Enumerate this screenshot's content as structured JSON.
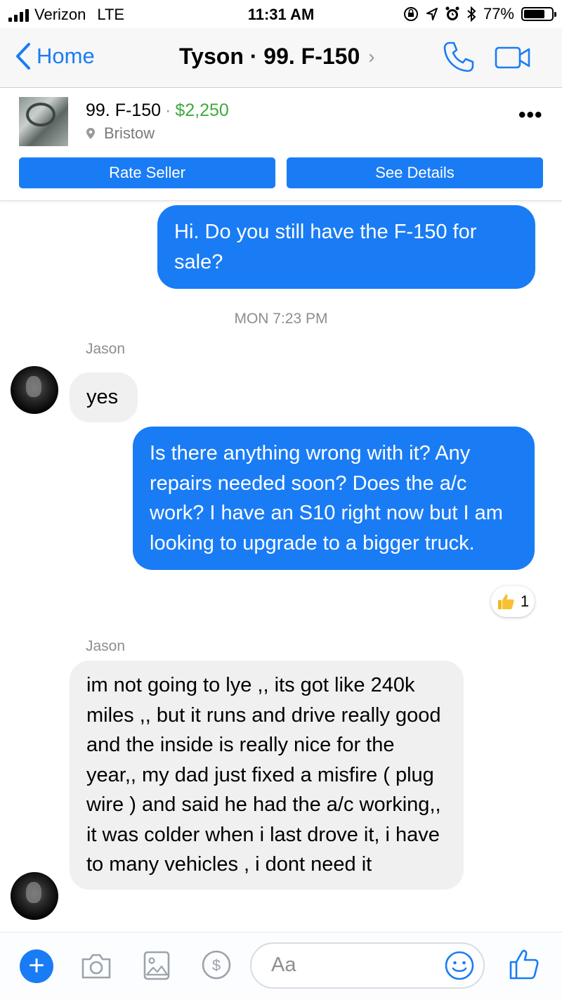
{
  "status_bar": {
    "carrier": "Verizon",
    "network": "LTE",
    "time": "11:31 AM",
    "battery_percent": "77%",
    "battery_level": 0.77
  },
  "nav": {
    "back_label": "Home",
    "title": "Tyson · 99. F-150",
    "title_chevron": "›",
    "icons": [
      "phone-icon",
      "video-icon"
    ],
    "accent_color": "#1a7cf5"
  },
  "listing": {
    "name": "99. F-150",
    "separator": "·",
    "price": "$2,250",
    "location": "Bristow",
    "more": "•••",
    "rate_seller_label": "Rate Seller",
    "see_details_label": "See Details",
    "price_color": "#3cab3c"
  },
  "messages": {
    "m1": "Hi. Do you still have the F-150 for sale?",
    "timestamp": "MON 7:23 PM",
    "sender1": "Jason",
    "m2": "yes",
    "m3": "Is there anything wrong with it? Any repairs needed soon? Does the a/c work? I have an S10 right now but I am looking to upgrade to a bigger truck.",
    "m3_reaction_count": "1",
    "sender2": "Jason",
    "m4": "im not going to lye ,, its got like 240k miles ,, but it runs and drive really good and the inside is really nice for the year,, my dad just fixed a misfire ( plug wire ) and said he had the a/c working,, it was colder when i last drove it, i have to many vehicles , i dont need it"
  },
  "composer": {
    "placeholder": "Aa",
    "icons": [
      "plus-icon",
      "camera-icon",
      "image-icon",
      "payment-icon",
      "emoji-icon",
      "thumbs-up-icon"
    ]
  }
}
